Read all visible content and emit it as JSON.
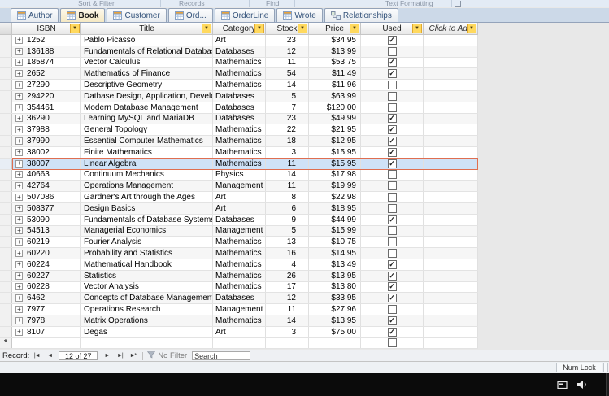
{
  "ribbon": {
    "groups": [
      "Sort & Filter",
      "Records",
      "Find",
      "Text Formatting"
    ]
  },
  "tabs": [
    {
      "label": "Author",
      "active": false
    },
    {
      "label": "Book",
      "active": true
    },
    {
      "label": "Customer",
      "active": false
    },
    {
      "label": "Ord...",
      "active": false
    },
    {
      "label": "OrderLine",
      "active": false
    },
    {
      "label": "Wrote",
      "active": false
    },
    {
      "label": "Relationships",
      "active": false
    }
  ],
  "table": {
    "columns": [
      "ISBN",
      "Title",
      "Category",
      "Stock",
      "Price",
      "Used",
      "Click to Add"
    ],
    "selected_isbn": "38007",
    "new_row_marker": "*",
    "rows": [
      {
        "isbn": "1252",
        "title": "Pablo Picasso",
        "category": "Art",
        "stock": 23,
        "price": "$34.95",
        "used": true
      },
      {
        "isbn": "136188",
        "title": "Fundamentals of Relational Database:",
        "category": "Databases",
        "stock": 12,
        "price": "$13.99",
        "used": false
      },
      {
        "isbn": "185874",
        "title": "Vector Calculus",
        "category": "Mathematics",
        "stock": 11,
        "price": "$53.75",
        "used": true
      },
      {
        "isbn": "2652",
        "title": "Mathematics of Finance",
        "category": "Mathematics",
        "stock": 54,
        "price": "$11.49",
        "used": true
      },
      {
        "isbn": "27290",
        "title": "Descriptive Geometry",
        "category": "Mathematics",
        "stock": 14,
        "price": "$11.96",
        "used": false
      },
      {
        "isbn": "294220",
        "title": "Datbase Design, Application, Develop",
        "category": "Databases",
        "stock": 5,
        "price": "$63.99",
        "used": false
      },
      {
        "isbn": "354461",
        "title": "Modern Database Management",
        "category": "Databases",
        "stock": 7,
        "price": "$120.00",
        "used": false
      },
      {
        "isbn": "36290",
        "title": "Learning MySQL and MariaDB",
        "category": "Databases",
        "stock": 23,
        "price": "$49.99",
        "used": true
      },
      {
        "isbn": "37988",
        "title": "General Topology",
        "category": "Mathematics",
        "stock": 22,
        "price": "$21.95",
        "used": true
      },
      {
        "isbn": "37990",
        "title": "Essential Computer Mathematics",
        "category": "Mathematics",
        "stock": 18,
        "price": "$12.95",
        "used": true
      },
      {
        "isbn": "38002",
        "title": "Finite Mathematics",
        "category": "Mathematics",
        "stock": 3,
        "price": "$15.95",
        "used": true
      },
      {
        "isbn": "38007",
        "title": "Linear Algebra",
        "category": "Mathematics",
        "stock": 11,
        "price": "$15.95",
        "used": true
      },
      {
        "isbn": "40663",
        "title": "Continuum Mechanics",
        "category": "Physics",
        "stock": 14,
        "price": "$17.98",
        "used": false
      },
      {
        "isbn": "42764",
        "title": "Operations Management",
        "category": "Management",
        "stock": 11,
        "price": "$19.99",
        "used": false
      },
      {
        "isbn": "507086",
        "title": "Gardner's Art through the Ages",
        "category": "Art",
        "stock": 8,
        "price": "$22.98",
        "used": false
      },
      {
        "isbn": "508377",
        "title": "Design Basics",
        "category": "Art",
        "stock": 6,
        "price": "$18.95",
        "used": false
      },
      {
        "isbn": "53090",
        "title": "Fundamentals of Database Systems",
        "category": "Databases",
        "stock": 9,
        "price": "$44.99",
        "used": true
      },
      {
        "isbn": "54513",
        "title": "Managerial Economics",
        "category": "Management",
        "stock": 5,
        "price": "$15.99",
        "used": false
      },
      {
        "isbn": "60219",
        "title": "Fourier Analysis",
        "category": "Mathematics",
        "stock": 13,
        "price": "$10.75",
        "used": false
      },
      {
        "isbn": "60220",
        "title": "Probability and Statistics",
        "category": "Mathematics",
        "stock": 16,
        "price": "$14.95",
        "used": false
      },
      {
        "isbn": "60224",
        "title": "Mathematical Handbook",
        "category": "Mathematics",
        "stock": 4,
        "price": "$13.49",
        "used": true
      },
      {
        "isbn": "60227",
        "title": "Statistics",
        "category": "Mathematics",
        "stock": 26,
        "price": "$13.95",
        "used": true
      },
      {
        "isbn": "60228",
        "title": "Vector Analysis",
        "category": "Mathematics",
        "stock": 17,
        "price": "$13.80",
        "used": true
      },
      {
        "isbn": "6462",
        "title": "Concepts of Database Management",
        "category": "Databases",
        "stock": 12,
        "price": "$33.95",
        "used": true
      },
      {
        "isbn": "7977",
        "title": "Operations Research",
        "category": "Management",
        "stock": 11,
        "price": "$27.96",
        "used": false
      },
      {
        "isbn": "7978",
        "title": "Matrix Operations",
        "category": "Mathematics",
        "stock": 14,
        "price": "$13.95",
        "used": true
      },
      {
        "isbn": "8107",
        "title": "Degas",
        "category": "Art",
        "stock": 3,
        "price": "$75.00",
        "used": true
      }
    ]
  },
  "record_nav": {
    "label": "Record:",
    "position": "12 of 27",
    "filter_label": "No Filter",
    "search_placeholder": "Search"
  },
  "status_bar": {
    "num_lock": "Num Lock"
  },
  "icons": {
    "nav_first": "|◄",
    "nav_previous": "◄",
    "nav_next": "►",
    "nav_last": "►|",
    "nav_new": "►*",
    "filter": "funnel",
    "tab": "table-grid",
    "relationships": "linked-tables",
    "tray": [
      "application",
      "volume"
    ],
    "filter_dropdown": "▼",
    "expand": "+"
  },
  "colors": {
    "selection_bg": "#cfe2f7",
    "selection_border": "#df6e50",
    "filter_arrow_bg": "#ffd95e",
    "active_tab_bg": "#f5e9c3",
    "taskbar_bg": "#0b0b0b"
  }
}
